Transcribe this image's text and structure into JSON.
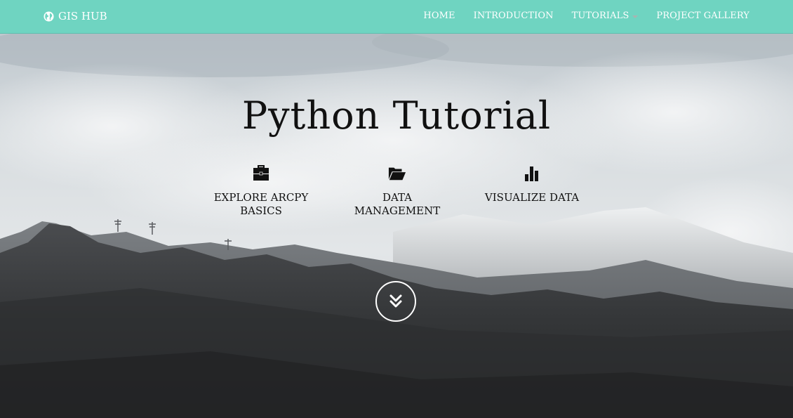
{
  "navbar": {
    "brand": {
      "label": "GIS HUB",
      "icon": "globe-icon"
    },
    "links": [
      {
        "label": "HOME"
      },
      {
        "label": "INTRODUCTION"
      },
      {
        "label": "TUTORIALS",
        "has_dropdown": true
      },
      {
        "label": "PROJECT GALLERY"
      }
    ],
    "background_color": "#6fd4c1"
  },
  "hero": {
    "title": "Python Tutorial",
    "features": [
      {
        "icon": "briefcase-icon",
        "label_line1": "EXPLORE ARCPY",
        "label_line2": "BASICS"
      },
      {
        "icon": "folder-open-icon",
        "label_line1": "DATA",
        "label_line2": "MANAGEMENT"
      },
      {
        "icon": "bar-chart-icon",
        "label_line1": "VISUALIZE DATA",
        "label_line2": ""
      }
    ],
    "scroll_button_icon": "double-chevron-down-icon"
  }
}
